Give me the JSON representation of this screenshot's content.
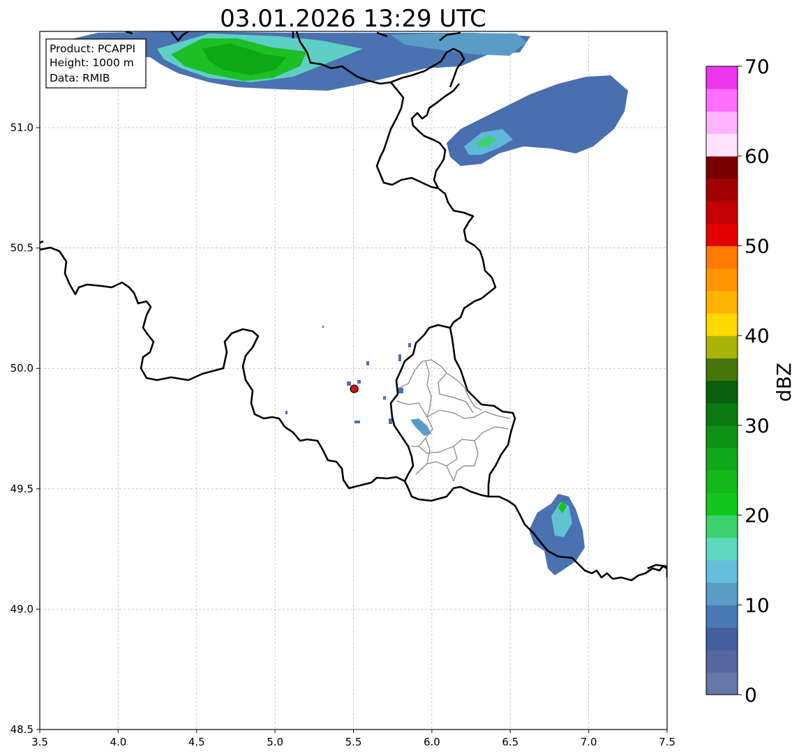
{
  "title": "03.01.2026 13:29 UTC",
  "info_box": {
    "product": "Product: PCAPPI",
    "height": "Height: 1000 m",
    "source": "Data: RMIB"
  },
  "map": {
    "lon_range": [
      3.5,
      7.5
    ],
    "lat_range": [
      48.5,
      51.4
    ],
    "x_ticks": [
      "3.5",
      "4.0",
      "4.5",
      "5.0",
      "5.5",
      "6.0",
      "6.5",
      "7.0",
      "7.5"
    ],
    "y_ticks": [
      "48.5",
      "49.0",
      "49.5",
      "50.0",
      "50.5",
      "51.0"
    ],
    "grid": true,
    "radar_site": {
      "lon": 5.505,
      "lat": 49.915,
      "color": "#e01010"
    }
  },
  "colorbar": {
    "label": "dBZ",
    "range": [
      0,
      70
    ],
    "tick_labels": [
      "0",
      "10",
      "20",
      "30",
      "40",
      "50",
      "60",
      "70"
    ],
    "colors": [
      "#6677aa",
      "#5566a0",
      "#445fa0",
      "#4a7ab5",
      "#5a9cc5",
      "#64bfdc",
      "#60d8c0",
      "#3cd36e",
      "#12c61c",
      "#12b81a",
      "#10a818",
      "#0e9215",
      "#0a7a12",
      "#095f0d",
      "#44760a",
      "#aab408",
      "#ffd800",
      "#ffb200",
      "#ff9600",
      "#ff7a00",
      "#e40000",
      "#c40000",
      "#a20000",
      "#7a0000",
      "#ffe2ff",
      "#ffb4ff",
      "#ff6eff",
      "#ee36ee"
    ]
  }
}
